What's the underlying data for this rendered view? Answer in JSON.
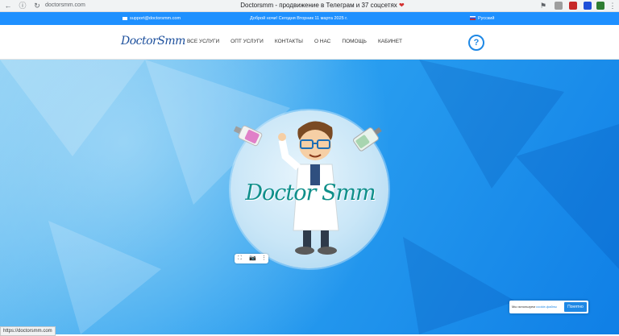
{
  "browser": {
    "url": "doctorsmm.com",
    "tab_title": "Doctorsmm - продвижение в Телеграм и 37 соцсетях",
    "status_url": "https://doctorsmm.com"
  },
  "info_bar": {
    "email": "support@doctorsmm.com",
    "greeting": "Доброй ночи! Сегодня Вторник 11 марта 2025 г.",
    "language": "Русский"
  },
  "nav": {
    "logo": "DoctorSmm",
    "items": [
      {
        "label": "ВСЕ УСЛУГИ"
      },
      {
        "label": "ОПТ УСЛУГИ"
      },
      {
        "label": "КОНТАКТЫ"
      },
      {
        "label": "О НАС"
      },
      {
        "label": "ПОМОЩЬ"
      },
      {
        "label": "КАБИНЕТ"
      }
    ],
    "help_symbol": "?"
  },
  "hero": {
    "logo_text": "Doctor Smm"
  },
  "cookie": {
    "text": "Мы используем",
    "link": "cookie-файлы",
    "button": "Понятно"
  },
  "colors": {
    "accent": "#1e90ff",
    "hero_dark": "#0f7fe6",
    "logo_teal": "#0f8f8a"
  },
  "icons": [
    "back-icon",
    "info-icon",
    "reload-icon",
    "lock-icon",
    "bookmark-icon",
    "mail-icon",
    "flag-ru-icon",
    "help-icon",
    "crop-icon",
    "camera-icon",
    "more-icon"
  ]
}
